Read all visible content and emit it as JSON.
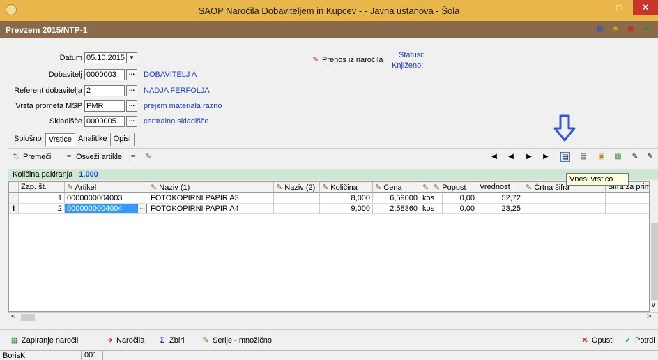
{
  "window": {
    "title": "SAOP  Naročila Dobaviteljem in Kupcev -  - Javna ustanova - Šola"
  },
  "subtitle": "Prevzem 2015/NTP-1",
  "header": {
    "datum_label": "Datum",
    "datum_value": "05.10.2015",
    "dobavitelj_label": "Dobavitelj",
    "dobavitelj_value": "0000003",
    "dobavitelj_name": "DOBAVITELJ  A",
    "referent_label": "Referent dobavitelja",
    "referent_value": "2",
    "referent_name": "NADJA FERFOLJA",
    "vrsta_label": "Vrsta prometa MSP",
    "vrsta_value": "PMR",
    "vrsta_name": "prejem materiala razno",
    "skladisce_label": "Skladišče",
    "skladisce_value": "0000005",
    "skladisce_name": "centralno skladišče",
    "prenos_label": "Prenos iz naročila",
    "statusi_label": "Statusi:",
    "knjizeno_label": "Knjiženo:"
  },
  "tabs": [
    "Splošno",
    "Vrstice",
    "Analitike",
    "Opisi"
  ],
  "toolbar": {
    "premeci": "Premeči",
    "osvezi": "Osveži artikle"
  },
  "kolicina": {
    "label": "Količina pakiranja",
    "value": "1,000"
  },
  "grid": {
    "headers": [
      "Zap. št.",
      "Artikel",
      "Naziv (1)",
      "Naziv (2)",
      "Količina",
      "Cena",
      "",
      "Popust",
      "Vrednost",
      "Črtna šifra",
      "Šifra za prime"
    ],
    "rows": [
      [
        "1",
        "0000000004003",
        "FOTOKOPIRNI PAPIR  A3",
        "",
        "8,000",
        "6,59000",
        "kos",
        "0,00",
        "52,72",
        "",
        ""
      ],
      [
        "2",
        "0000000004004",
        "FOTOKOPIRNI PAPIR  A4",
        "",
        "9,000",
        "2,58360",
        "kos",
        "0,00",
        "23,25",
        "",
        ""
      ]
    ]
  },
  "tooltip": "Vnesi vrstico",
  "bottom": {
    "zapiranje": "Zapiranje naročil",
    "narocila": "Naročila",
    "zbiri": "Zbiri",
    "serije": "Serije - množično",
    "opusti": "Opusti",
    "potrdi": "Potrdi"
  },
  "status": {
    "user": "BorisK",
    "code": "001"
  },
  "colors": {
    "titlebar": "#e8b64b",
    "subbar": "#8a6a4a",
    "accent_blue": "#1a3cc8",
    "greenbar": "#cfe6d4"
  }
}
